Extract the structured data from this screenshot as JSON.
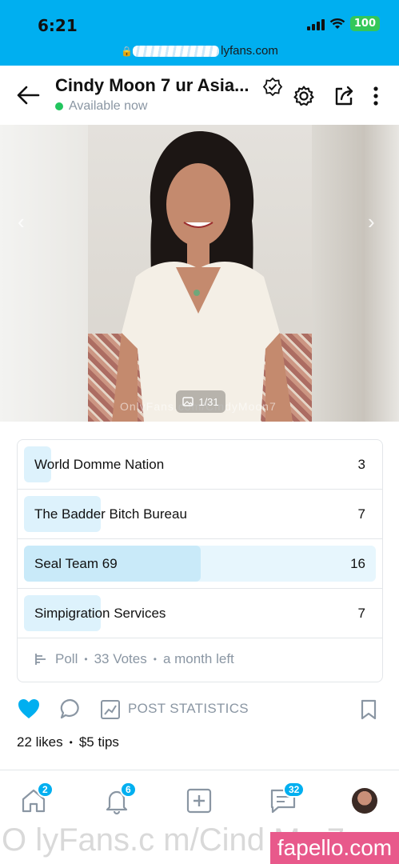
{
  "status_bar": {
    "time": "6:21",
    "battery": "100"
  },
  "browser": {
    "url_visible": "lyfans.com"
  },
  "header": {
    "title": "Cindy Moon 7 ur Asia...",
    "status": "Available now"
  },
  "photo": {
    "counter": "1/31",
    "watermark": "OnlyFans.com/CindyMoon7"
  },
  "poll": {
    "options": [
      {
        "label": "World Domme Nation",
        "count": "3"
      },
      {
        "label": "The Badder Bitch Bureau",
        "count": "7"
      },
      {
        "label": "Seal Team 69",
        "count": "16"
      },
      {
        "label": "Simpigration Services",
        "count": "7"
      }
    ],
    "footer": {
      "type": "Poll",
      "votes": "33 Votes",
      "remaining": "a month left"
    }
  },
  "actions": {
    "stats_label": "POST STATISTICS"
  },
  "post_meta": {
    "likes": "22 likes",
    "tips": "$5 tips"
  },
  "nav": {
    "home_badge": "2",
    "notifications_badge": "6",
    "messages_badge": "32"
  },
  "overlay": {
    "watermark_text": "O lyFans.c m/Cind  Mo    7",
    "site_badge": "fapello.com"
  },
  "colors": {
    "brand": "#00aff0",
    "like": "#00aff0",
    "online": "#22c55e",
    "muted": "#8a96a3"
  }
}
